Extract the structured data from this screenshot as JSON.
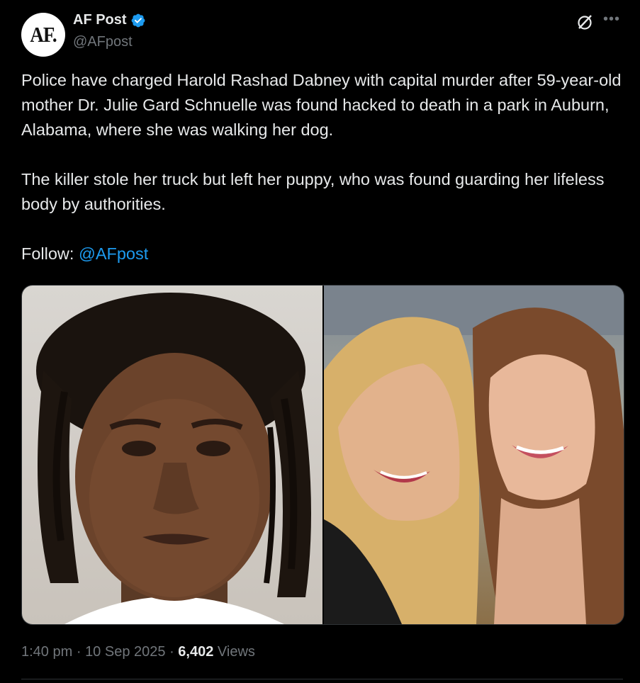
{
  "author": {
    "avatar_text": "AF.",
    "display_name": "AF Post",
    "handle": "@AFpost",
    "verified": true
  },
  "post": {
    "paragraph1": "Police have charged Harold Rashad Dabney with capital murder after 59-year-old mother Dr. Julie Gard Schnuelle was found hacked to death in a park in Auburn, Alabama, where she was walking her dog.",
    "paragraph2": "The killer stole her truck but left her puppy, who was found guarding her lifeless body by authorities.",
    "follow_label": "Follow:",
    "follow_mention": "@AFpost"
  },
  "media": {
    "images": [
      {
        "depicts": "mugshot-photo"
      },
      {
        "depicts": "two-women-smiling-photo"
      }
    ]
  },
  "meta": {
    "time": "1:40 pm",
    "separator": "·",
    "date": "10 Sep 2025",
    "views_count": "6,402",
    "views_label": "Views"
  },
  "colors": {
    "background": "#000000",
    "text": "#e7e9ea",
    "muted": "#71767b",
    "accent": "#1d9bf0"
  },
  "icons": {
    "verified": "verified-badge-icon",
    "grok": "grok-icon",
    "more": "more-options-icon"
  }
}
